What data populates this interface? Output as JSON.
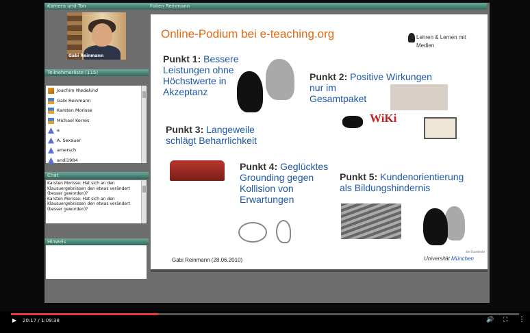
{
  "panels": {
    "camera": "Kamera und Ton",
    "participants": "Teilnehmerliste (115)",
    "chat": "Chat",
    "hint": "Hinweis",
    "slide": "Folien Reinmann"
  },
  "camera_caption": "Gabi Reinmann",
  "participants": [
    {
      "name": "Joachim Wedekind",
      "role": "moderator"
    },
    {
      "name": "Gabi Reinmann",
      "role": "presenter"
    },
    {
      "name": "Karsten Morisse",
      "role": "presenter"
    },
    {
      "name": "Michael Kerres",
      "role": "presenter"
    },
    {
      "name": "a",
      "role": "user"
    },
    {
      "name": "A. Sexauer",
      "role": "user"
    },
    {
      "name": "amersch",
      "role": "user"
    },
    {
      "name": "andi1984",
      "role": "user"
    }
  ],
  "chat_messages": [
    "Karsten Morisse: Hat sich an den Klausuergebnissen den etwas verändert (besser geworden)?",
    "Karsten Morisse: Hat sich an den Klausuergebnissen den etwas verändert (besser geworden)?"
  ],
  "slide": {
    "title": "Online-Podium bei e-teaching.org",
    "logo_line1": "Lehren & Lernen mit",
    "logo_line2": "Medien",
    "p1_label": "Punkt 1:",
    "p1_text1": "Bessere",
    "p1_text2": "Leistungen ohne",
    "p1_text3": "Höchstwerte in",
    "p1_text4": "Akzeptanz",
    "p2_label": "Punkt 2:",
    "p2_text1": "Positive Wirkungen",
    "p2_text2": "nur im",
    "p2_text3": "Gesamtpaket",
    "p3_label": "Punkt 3:",
    "p3_text1": "Langeweile",
    "p3_text2": "schlägt Beharrlichkeit",
    "p4_label": "Punkt 4:",
    "p4_text1": "Geglücktes",
    "p4_text2": "Grounding gegen",
    "p4_text3": "Kollision von",
    "p4_text4": "Erwartungen",
    "p5_label": "Punkt 5:",
    "p5_text1": "Kundenorientierung",
    "p5_text2": "als Bildungshindernis",
    "wiki": "WiKi",
    "footer": "Gabi Reinmann (28.06.2010)",
    "university_prefix": "Universität",
    "university_city": "München",
    "university_tag": "die Exzellente"
  },
  "player": {
    "time": "20:17 / 1:09:38",
    "progress": 0.29
  }
}
